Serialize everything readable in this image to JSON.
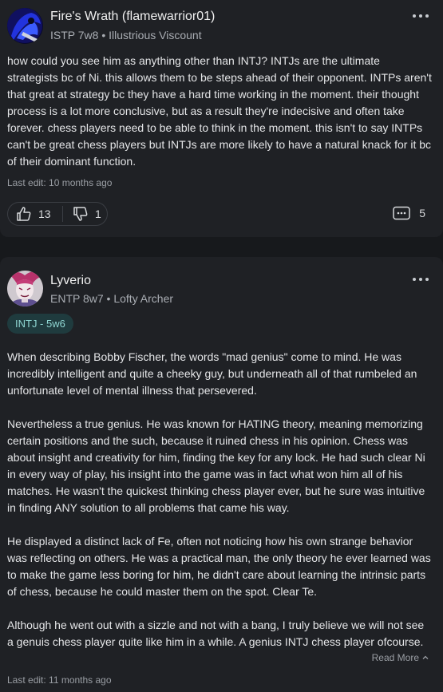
{
  "posts": [
    {
      "author": "Fire's Wrath (flamewarrior01)",
      "meta": "ISTP 7w8 • Illustrious Viscount",
      "paragraphs": [
        "how could you see him as anything other than INTJ? INTJs are the ultimate strategists bc of Ni. this allows them to be steps ahead of their opponent. INTPs aren't that great at strategy bc they have a hard time working in the moment. their thought process is a lot more conclusive, but as a result they're indecisive and often take forever. chess players need to be able to think in the moment. this isn't to say INTPs can't be great chess players but INTJs are more likely to have a natural knack for it bc of their dominant function."
      ],
      "last_edit": "Last edit: 10 months ago",
      "likes": "13",
      "dislikes": "1",
      "comments": "5"
    },
    {
      "author": "Lyverio",
      "meta": "ENTP 8w7 • Lofty Archer",
      "vote_tag": "INTJ - 5w6",
      "paragraphs": [
        "When describing Bobby Fischer, the words \"mad genius\" come to mind. He was incredibly intelligent and quite a cheeky guy, but underneath all of that rumbeled an unfortunate level of mental illness that persevered.",
        "Nevertheless a true genius. He was known for HATING theory, meaning memorizing certain positions and the such, because it ruined chess in his opinion. Chess was about insight and creativity for him, finding the key for any lock. He had such clear Ni in every way of play, his insight into the game was in fact what won him all of his matches. He wasn't the quickest thinking chess player ever, but he sure was intuitive in finding ANY solution to all problems that came his way.",
        "He displayed a distinct lack of Fe, often not noticing how his own strange behavior was reflecting on others. He was a practical man, the only theory he ever learned was to make the game less boring for him, he didn't care about learning the intrinsic parts of chess, because he could master them on the spot. Clear Te.",
        "Although he went out with a sizzle and not with a bang, I truly believe we will not see a genuis chess player quite like him in a while. A genius INTJ chess player ofcourse."
      ],
      "read_more": "Read More",
      "last_edit": "Last edit: 11 months ago"
    }
  ],
  "icons": {
    "more": "more-options-icon",
    "like": "thumbs-up-icon",
    "dislike": "thumbs-down-icon",
    "comment": "comment-icon",
    "read_more": "chevron-up-icon"
  },
  "colors": {
    "background": "#17191c",
    "card": "#1f2125",
    "tag_bg": "#1f3b3e",
    "tag_text": "#8fd6d2"
  }
}
